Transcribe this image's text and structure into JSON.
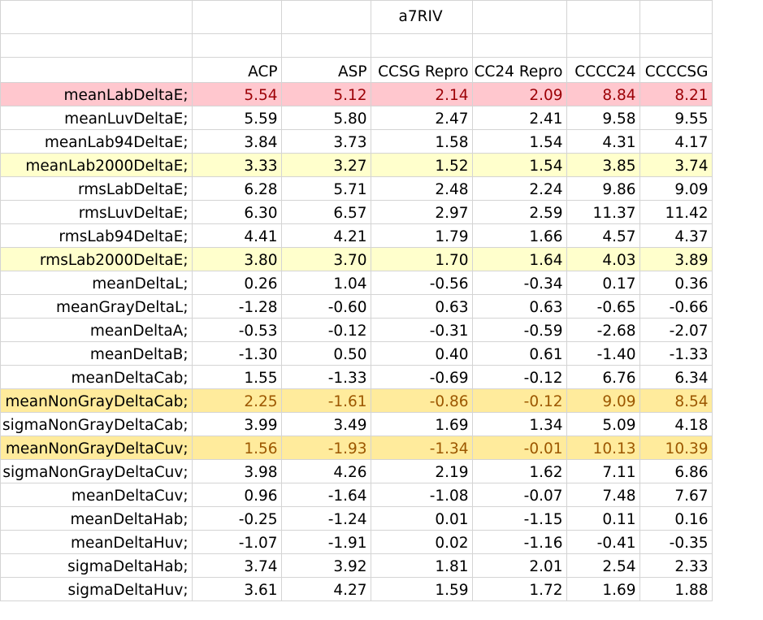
{
  "sheet": {
    "title": "a7RIV",
    "headers": [
      "",
      "ACP",
      "ASP",
      "CCSG Repro",
      "CC24 Repro",
      "CCCC24",
      "CCCCSG"
    ],
    "rows": [
      {
        "label": "meanLabDeltaE;",
        "values": [
          "5.54",
          "5.12",
          "2.14",
          "2.09",
          "8.84",
          "8.21"
        ],
        "highlight": "red"
      },
      {
        "label": "meanLuvDeltaE;",
        "values": [
          "5.59",
          "5.80",
          "2.47",
          "2.41",
          "9.58",
          "9.55"
        ],
        "highlight": "none"
      },
      {
        "label": "meanLab94DeltaE;",
        "values": [
          "3.84",
          "3.73",
          "1.58",
          "1.54",
          "4.31",
          "4.17"
        ],
        "highlight": "none"
      },
      {
        "label": "meanLab2000DeltaE;",
        "values": [
          "3.33",
          "3.27",
          "1.52",
          "1.54",
          "3.85",
          "3.74"
        ],
        "highlight": "yellow"
      },
      {
        "label": "rmsLabDeltaE;",
        "values": [
          "6.28",
          "5.71",
          "2.48",
          "2.24",
          "9.86",
          "9.09"
        ],
        "highlight": "none"
      },
      {
        "label": "rmsLuvDeltaE;",
        "values": [
          "6.30",
          "6.57",
          "2.97",
          "2.59",
          "11.37",
          "11.42"
        ],
        "highlight": "none"
      },
      {
        "label": "rmsLab94DeltaE;",
        "values": [
          "4.41",
          "4.21",
          "1.79",
          "1.66",
          "4.57",
          "4.37"
        ],
        "highlight": "none"
      },
      {
        "label": "rmsLab2000DeltaE;",
        "values": [
          "3.80",
          "3.70",
          "1.70",
          "1.64",
          "4.03",
          "3.89"
        ],
        "highlight": "yellow"
      },
      {
        "label": "meanDeltaL;",
        "values": [
          "0.26",
          "1.04",
          "-0.56",
          "-0.34",
          "0.17",
          "0.36"
        ],
        "highlight": "none"
      },
      {
        "label": "meanGrayDeltaL;",
        "values": [
          "-1.28",
          "-0.60",
          "0.63",
          "0.63",
          "-0.65",
          "-0.66"
        ],
        "highlight": "none"
      },
      {
        "label": "meanDeltaA;",
        "values": [
          "-0.53",
          "-0.12",
          "-0.31",
          "-0.59",
          "-2.68",
          "-2.07"
        ],
        "highlight": "none"
      },
      {
        "label": "meanDeltaB;",
        "values": [
          "-1.30",
          "0.50",
          "0.40",
          "0.61",
          "-1.40",
          "-1.33"
        ],
        "highlight": "none"
      },
      {
        "label": "meanDeltaCab;",
        "values": [
          "1.55",
          "-1.33",
          "-0.69",
          "-0.12",
          "6.76",
          "6.34"
        ],
        "highlight": "none"
      },
      {
        "label": "meanNonGrayDeltaCab;",
        "values": [
          "2.25",
          "-1.61",
          "-0.86",
          "-0.12",
          "9.09",
          "8.54"
        ],
        "highlight": "amber"
      },
      {
        "label": "sigmaNonGrayDeltaCab;",
        "values": [
          "3.99",
          "3.49",
          "1.69",
          "1.34",
          "5.09",
          "4.18"
        ],
        "highlight": "none"
      },
      {
        "label": "meanNonGrayDeltaCuv;",
        "values": [
          "1.56",
          "-1.93",
          "-1.34",
          "-0.01",
          "10.13",
          "10.39"
        ],
        "highlight": "amber"
      },
      {
        "label": "sigmaNonGrayDeltaCuv;",
        "values": [
          "3.98",
          "4.26",
          "2.19",
          "1.62",
          "7.11",
          "6.86"
        ],
        "highlight": "none"
      },
      {
        "label": "meanDeltaCuv;",
        "values": [
          "0.96",
          "-1.64",
          "-1.08",
          "-0.07",
          "7.48",
          "7.67"
        ],
        "highlight": "none"
      },
      {
        "label": "meanDeltaHab;",
        "values": [
          "-0.25",
          "-1.24",
          "0.01",
          "-1.15",
          "0.11",
          "0.16"
        ],
        "highlight": "none"
      },
      {
        "label": "meanDeltaHuv;",
        "values": [
          "-1.07",
          "-1.91",
          "0.02",
          "-1.16",
          "-0.41",
          "-0.35"
        ],
        "highlight": "none"
      },
      {
        "label": "sigmaDeltaHab;",
        "values": [
          "3.74",
          "3.92",
          "1.81",
          "2.01",
          "2.54",
          "2.33"
        ],
        "highlight": "none"
      },
      {
        "label": "sigmaDeltaHuv;",
        "values": [
          "3.61",
          "4.27",
          "1.59",
          "1.72",
          "1.69",
          "1.88"
        ],
        "highlight": "none"
      }
    ]
  },
  "colors": {
    "gridline": "#d4d4d4",
    "red_fill": "#ffc7ce",
    "red_text": "#9c0006",
    "yellow_fill": "#ffffcc",
    "amber_fill": "#ffeb9c",
    "amber_text": "#9c5700"
  }
}
